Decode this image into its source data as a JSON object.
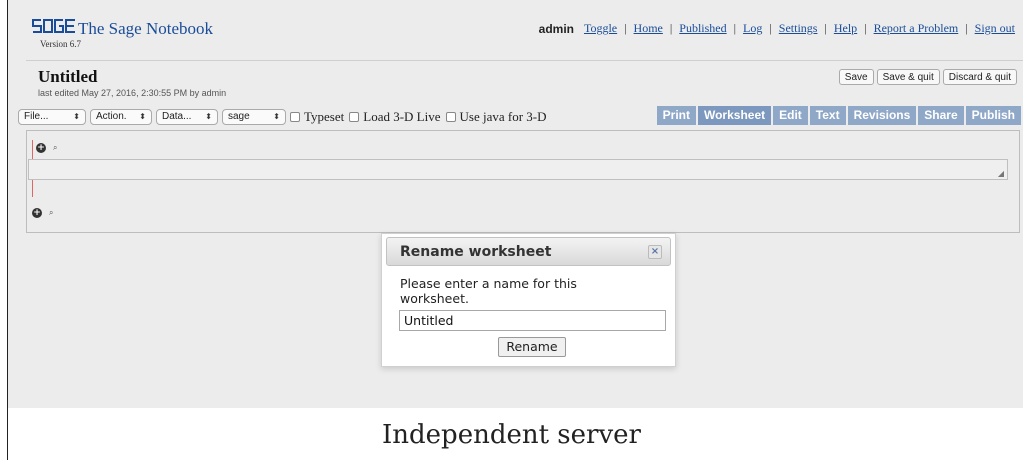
{
  "header": {
    "logo_text": "sage",
    "app_name": "The Sage Notebook",
    "version": "Version 6.7",
    "user": "admin",
    "nav": [
      "Toggle",
      "Home",
      "Published",
      "Log",
      "Settings",
      "Help",
      "Report a Problem",
      "Sign out"
    ]
  },
  "worksheet": {
    "title": "Untitled",
    "last_edited": "last edited May 27, 2016, 2:30:55 PM by admin",
    "actions": {
      "save": "Save",
      "save_quit": "Save & quit",
      "discard_quit": "Discard & quit"
    }
  },
  "controls": {
    "file_menu": "File...",
    "action_menu": "Action.",
    "data_menu": "Data...",
    "system_select": "sage",
    "typeset": "Typeset",
    "load3d": "Load 3-D Live",
    "java3d": "Use java for 3-D"
  },
  "tabs": [
    "Print",
    "Worksheet",
    "Edit",
    "Text",
    "Revisions",
    "Share",
    "Publish"
  ],
  "cell": {
    "input_value": ""
  },
  "dialog": {
    "title": "Rename worksheet",
    "message": "Please enter a name for this worksheet.",
    "input_value": "Untitled",
    "button": "Rename",
    "close_glyph": "×"
  },
  "caption": "Independent server",
  "colors": {
    "link": "#1a4d99",
    "tab": "#8fa8c8",
    "cell_marker": "#e06666"
  }
}
